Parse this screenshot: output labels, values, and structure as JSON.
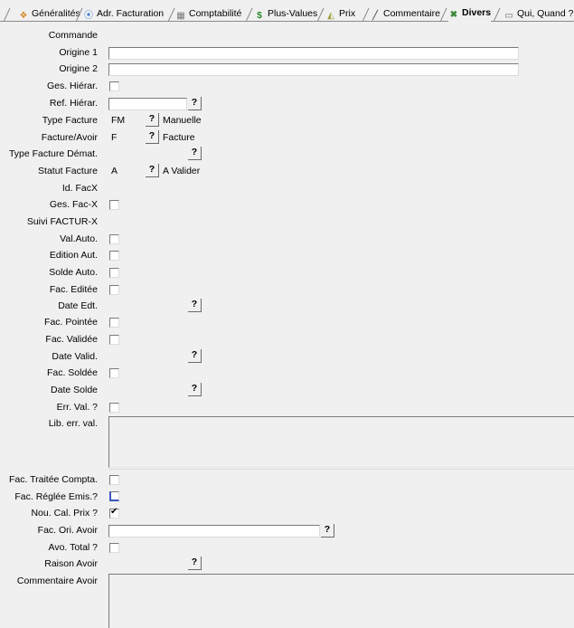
{
  "tabs": [
    {
      "label": "Généralités",
      "icon": "general-icon"
    },
    {
      "label": "Adr. Facturation",
      "icon": "address-icon"
    },
    {
      "label": "Comptabilité",
      "icon": "accounting-icon"
    },
    {
      "label": "Plus-Values",
      "icon": "dollar-icon"
    },
    {
      "label": "Prix",
      "icon": "price-icon"
    },
    {
      "label": "Commentaire",
      "icon": "pencil-icon"
    },
    {
      "label": "Divers",
      "icon": "misc-icon",
      "active": true
    },
    {
      "label": "Qui, Quand ?",
      "icon": "who-when-icon"
    }
  ],
  "fields": {
    "commande": "Commande",
    "origine1": "Origine 1",
    "origine2": "Origine 2",
    "ges_hierar": "Ges. Hiérar.",
    "ref_hierar": "Ref. Hiérar.",
    "type_facture": "Type Facture",
    "type_facture_code": "FM",
    "type_facture_desc": "Manuelle",
    "facture_avoir": "Facture/Avoir",
    "facture_avoir_code": "F",
    "facture_avoir_desc": "Facture",
    "type_facture_demat": "Type Facture Démat.",
    "statut_facture": "Statut Facture",
    "statut_facture_code": "A",
    "statut_facture_desc": "A Valider",
    "id_facx": "Id. FacX",
    "ges_facx": "Ges. Fac-X",
    "suivi_factur": "Suivi FACTUR-X",
    "val_auto": "Val.Auto.",
    "edition_aut": "Edition Aut.",
    "solde_auto": "Solde Auto.",
    "fac_editee": "Fac. Editée",
    "date_edt": "Date Edt.",
    "fac_pointee": "Fac. Pointée",
    "fac_validee": "Fac. Validée",
    "date_valid": "Date Valid.",
    "fac_soldee": "Fac. Soldée",
    "date_solde": "Date Solde",
    "err_val": "Err. Val. ?",
    "lib_err_val": "Lib. err. val.",
    "fac_traitee_compta": "Fac. Traitée Compta.",
    "fac_reglee_emis": "Fac. Réglée Emis.?",
    "nou_cal_prix": "Nou. Cal. Prix ?",
    "fac_ori_avoir": "Fac. Ori. Avoir",
    "avo_total": "Avo. Total ?",
    "raison_avoir": "Raison Avoir",
    "commentaire_avoir": "Commentaire Avoir"
  },
  "buttons": {
    "lookup": "?"
  },
  "checks": {
    "nou_cal_prix": true
  }
}
